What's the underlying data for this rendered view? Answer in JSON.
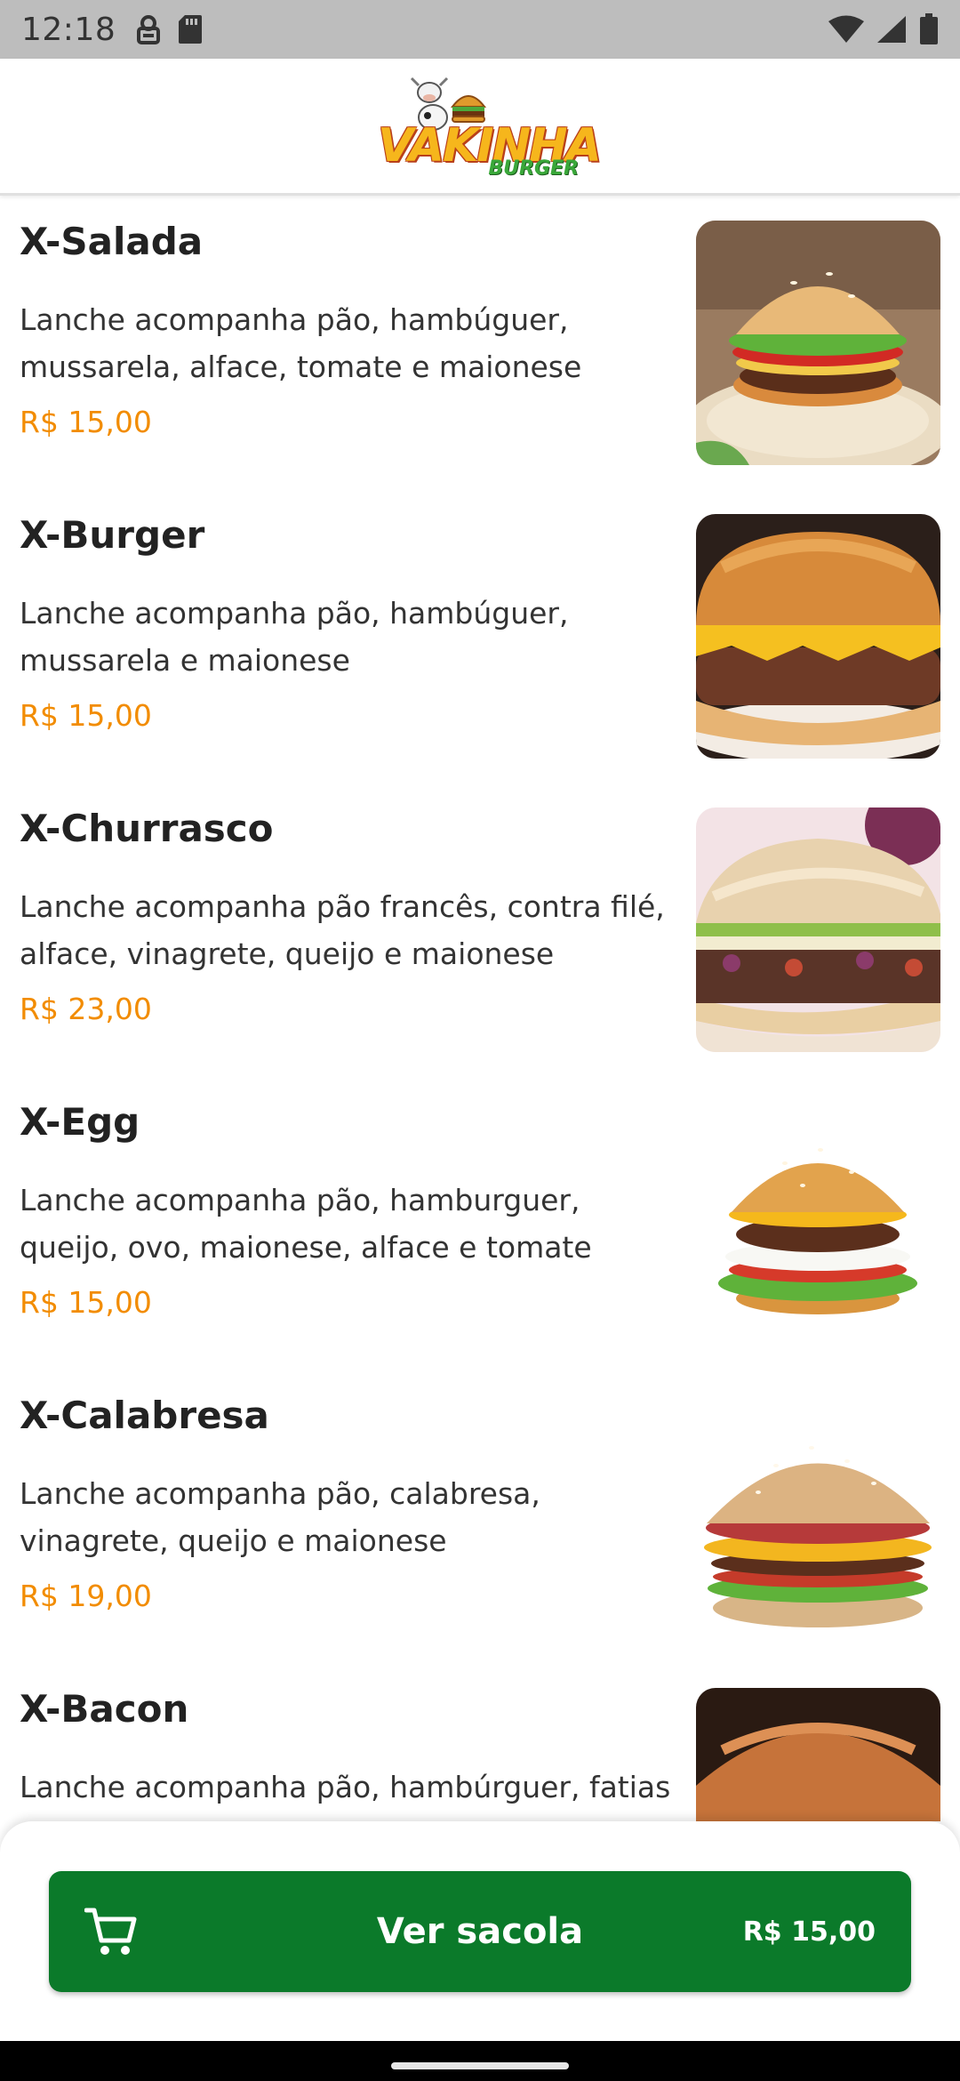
{
  "status_bar": {
    "time": "12:18"
  },
  "app_bar": {
    "logo_text": "VAKINHA",
    "logo_subtext": "BURGER"
  },
  "products": [
    {
      "name": "X-Salada",
      "description": "Lanche acompanha pão, hambúguer, mussarela, alface, tomate e maionese",
      "price": "R$ 15,00",
      "image_icon": "burger-salad-image"
    },
    {
      "name": "X-Burger",
      "description": "Lanche acompanha pão, hambúguer, mussarela e maionese",
      "price": "R$ 15,00",
      "image_icon": "burger-cheese-image"
    },
    {
      "name": "X-Churrasco",
      "description": "Lanche acompanha pão francês, contra filé, alface, vinagrete, queijo e maionese",
      "price": "R$ 23,00",
      "image_icon": "steak-sandwich-image"
    },
    {
      "name": "X-Egg",
      "description": "Lanche acompanha pão, hamburguer, queijo, ovo, maionese, alface e tomate",
      "price": "R$ 15,00",
      "image_icon": "burger-egg-image"
    },
    {
      "name": "X-Calabresa",
      "description": "Lanche acompanha pão, calabresa, vinagrete, queijo e maionese",
      "price": "R$ 19,00",
      "image_icon": "burger-sausage-image"
    },
    {
      "name": "X-Bacon",
      "description": "Lanche acompanha pão, hambúrguer, fatias",
      "price": "",
      "image_icon": "burger-bacon-image"
    }
  ],
  "bag": {
    "label": "Ver sacola",
    "total": "R$ 15,00",
    "icon": "cart-icon"
  },
  "colors": {
    "accent_green": "#0b7a2a",
    "price_orange": "#f28c00",
    "status_bar_gray": "#bdbdbd"
  }
}
